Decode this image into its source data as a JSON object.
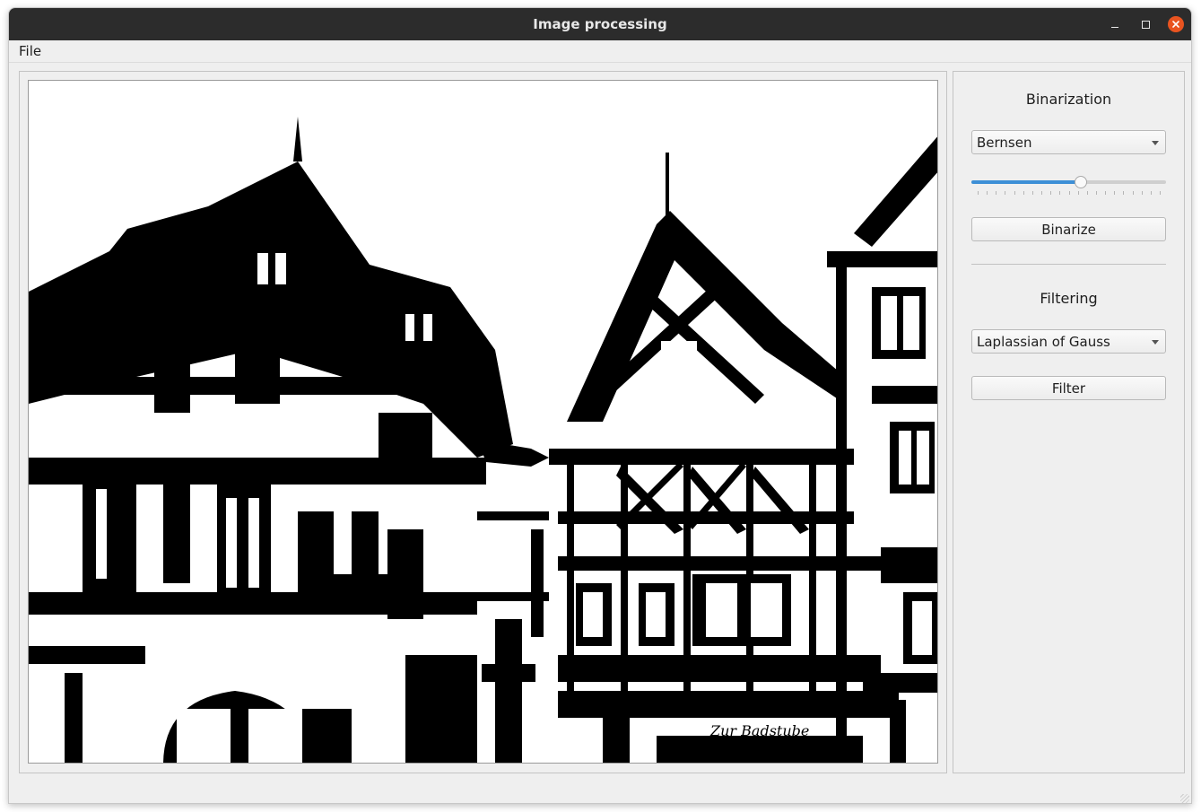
{
  "window": {
    "title": "Image processing",
    "controls": {
      "minimize_icon": "minimize-icon",
      "maximize_icon": "maximize-icon",
      "close_icon": "close-icon"
    },
    "close_color": "#e95420"
  },
  "menubar": {
    "items": [
      {
        "label": "File"
      }
    ]
  },
  "image_view": {
    "content": "binarized-building-photo",
    "sign_text": "Zur Badstube"
  },
  "binarization": {
    "title": "Binarization",
    "method": {
      "selected": "Bernsen"
    },
    "slider": {
      "value_fraction": 0.56,
      "tick_count": 20
    },
    "button_label": "Binarize"
  },
  "filtering": {
    "title": "Filtering",
    "method": {
      "selected": "Laplassian of Gauss"
    },
    "button_label": "Filter"
  },
  "accent_color": "#3d8fd6"
}
